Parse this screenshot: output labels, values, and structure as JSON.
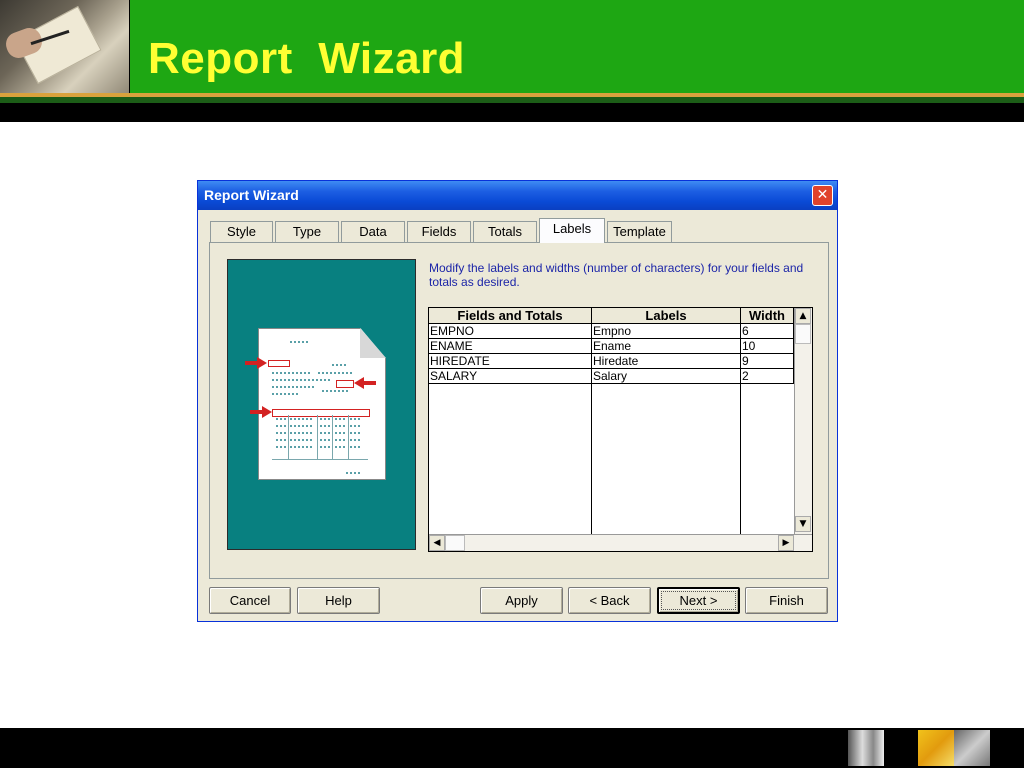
{
  "slide": {
    "title": "Report  Wizard"
  },
  "dialog": {
    "title": "Report Wizard",
    "close_symbol": "✕",
    "tabs": [
      {
        "label": "Style"
      },
      {
        "label": "Type"
      },
      {
        "label": "Data"
      },
      {
        "label": "Fields"
      },
      {
        "label": "Totals"
      },
      {
        "label": "Labels",
        "active": true
      },
      {
        "label": "Template"
      }
    ],
    "instructions": "Modify the labels and widths (number of characters) for your fields and totals as desired.",
    "grid": {
      "headers": [
        "Fields and Totals",
        "Labels",
        "Width"
      ],
      "rows": [
        {
          "field": "EMPNO",
          "label": "Empno",
          "width": "6"
        },
        {
          "field": "ENAME",
          "label": "Ename",
          "width": "10"
        },
        {
          "field": "HIREDATE",
          "label": "Hiredate",
          "width": "9"
        },
        {
          "field": "SALARY",
          "label": "Salary",
          "width": "2"
        }
      ]
    },
    "buttons": {
      "cancel": "Cancel",
      "help": "Help",
      "apply": "Apply",
      "back": "< Back",
      "next": "Next >",
      "finish": "Finish"
    }
  },
  "colors": {
    "header_green": "#1ea713",
    "title_yellow": "#ffff33",
    "preview_teal": "#088080",
    "instruction_blue": "#1c25a8"
  }
}
